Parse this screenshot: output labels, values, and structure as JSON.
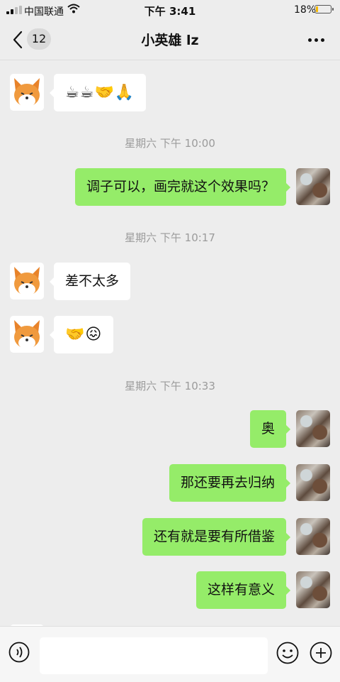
{
  "status_bar": {
    "carrier": "中国联通",
    "time": "下午 3:41",
    "battery_percent": "18%",
    "battery_level": 0.18
  },
  "nav": {
    "unread_count": "12",
    "title": "小英雄 lz"
  },
  "messages": [
    {
      "side": "left",
      "kind": "emoji",
      "text": "☕☕🤝🙏"
    },
    {
      "side": "time",
      "text": "星期六 下午 10:00"
    },
    {
      "side": "right",
      "kind": "text",
      "text": "调子可以，画完就这个效果吗？"
    },
    {
      "side": "time",
      "text": "星期六 下午 10:17"
    },
    {
      "side": "left",
      "kind": "text",
      "text": "差不太多"
    },
    {
      "side": "left",
      "kind": "emoji",
      "text": "🤝😖"
    },
    {
      "side": "time",
      "text": "星期六 下午 10:33"
    },
    {
      "side": "right",
      "kind": "text",
      "text": "奥"
    },
    {
      "side": "right",
      "kind": "text",
      "text": "那还要再去归纳"
    },
    {
      "side": "right",
      "kind": "text",
      "text": "还有就是要有所借鉴"
    },
    {
      "side": "right",
      "kind": "text",
      "text": "这样有意义"
    }
  ],
  "colors": {
    "background": "#ededed",
    "bubble_sent": "#95ec69",
    "bubble_received": "#ffffff",
    "timestamp": "#9b9b9b"
  },
  "icons": {
    "back": "chevron-left-icon",
    "more": "more-dots-icon",
    "voice": "voice-icon",
    "emoji": "smile-icon",
    "plus": "plus-icon",
    "contact_avatar": "fox-avatar",
    "self_avatar": "photo-avatar"
  }
}
